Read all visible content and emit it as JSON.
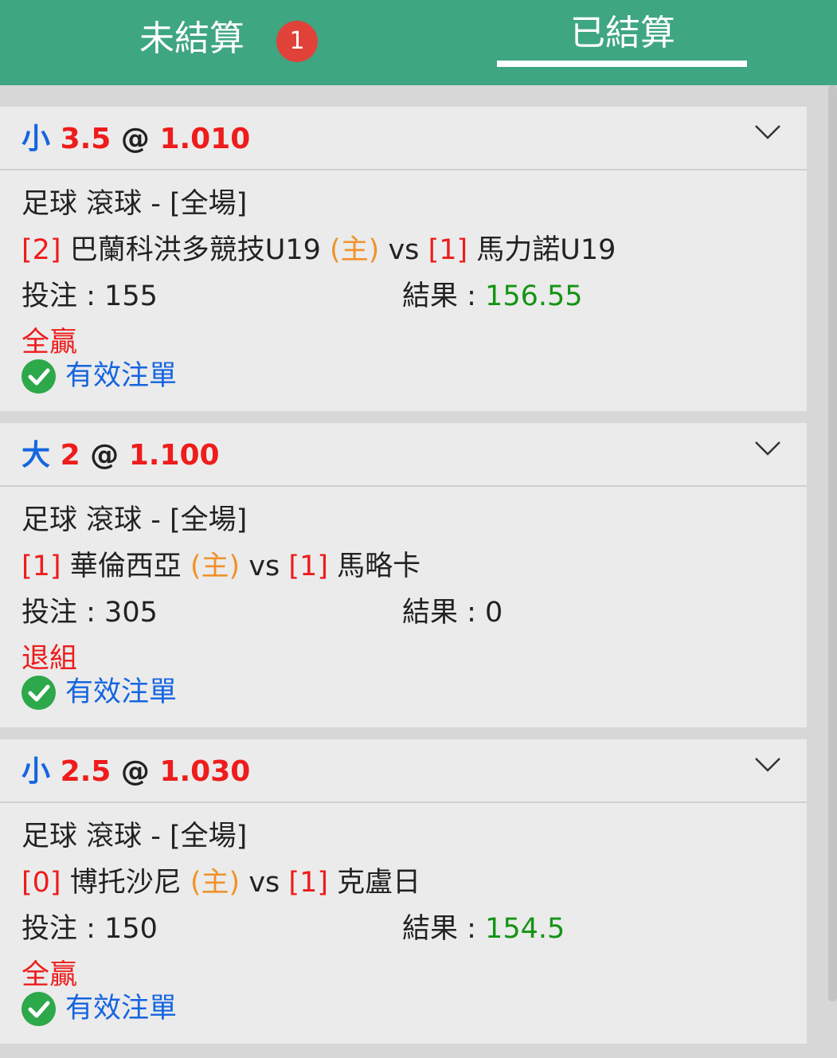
{
  "tabs": {
    "unsettled_label": "未結算",
    "unsettled_badge": "1",
    "settled_label": "已結算"
  },
  "bets": [
    {
      "pick": "小",
      "line": "3.5",
      "at": "@",
      "odds": "1.010",
      "sport": "足球 滾球 - [全場]",
      "home_score": "[2]",
      "home_team": "巴蘭科洪多競技U19",
      "home_marker": "(主)",
      "vs": "vs",
      "away_score": "[1]",
      "away_team": "馬力諾U19",
      "stake_label": "投注 : ",
      "stake": "155",
      "result_label": "結果 : ",
      "result": "156.55",
      "outcome": "全贏",
      "status": "有效注單"
    },
    {
      "pick": "大",
      "line": "2",
      "at": "@",
      "odds": "1.100",
      "sport": "足球 滾球 - [全場]",
      "home_score": "[1]",
      "home_team": "華倫西亞",
      "home_marker": "(主)",
      "vs": "vs",
      "away_score": "[1]",
      "away_team": "馬略卡",
      "stake_label": "投注 : ",
      "stake": "305",
      "result_label": "結果 : ",
      "result": "0",
      "outcome": "退組",
      "status": "有效注單"
    },
    {
      "pick": "小",
      "line": "2.5",
      "at": "@",
      "odds": "1.030",
      "sport": "足球 滾球 - [全場]",
      "home_score": "[0]",
      "home_team": "博托沙尼",
      "home_marker": "(主)",
      "vs": "vs",
      "away_score": "[1]",
      "away_team": "克盧日",
      "stake_label": "投注 : ",
      "stake": "150",
      "result_label": "結果 : ",
      "result": "154.5",
      "outcome": "全贏",
      "status": "有效注單"
    }
  ],
  "icons": {
    "expand": "chevron-down-icon",
    "valid": "check-circle-icon"
  },
  "colors": {
    "header_green": "#3fa682",
    "pick_blue": "#1565e0",
    "red": "#ee1c1c",
    "home_orange": "#f0922a",
    "win_green": "#149414"
  }
}
